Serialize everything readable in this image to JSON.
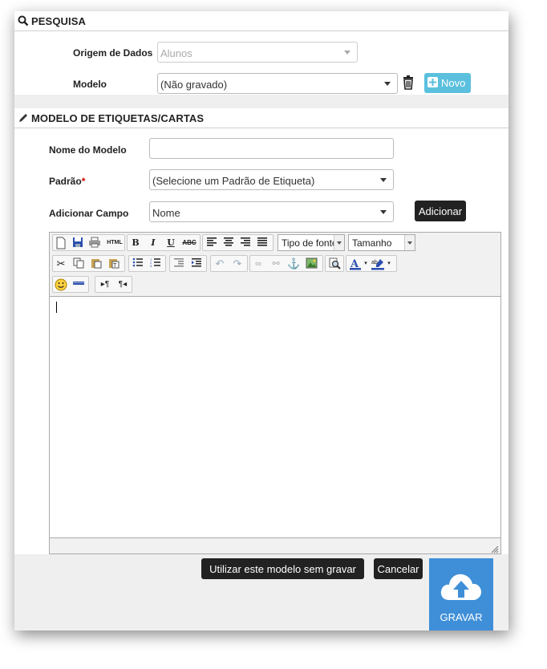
{
  "pesquisa": {
    "title": "PESQUISA",
    "origem_label": "Origem de Dados",
    "origem_value": "Alunos",
    "modelo_label": "Modelo",
    "modelo_value": "(Não gravado)",
    "novo_label": "Novo"
  },
  "modelo_etiquetas": {
    "title": "MODELO DE ETIQUETAS/CARTAS",
    "nome_label": "Nome do Modelo",
    "nome_value": "",
    "padrao_label": "Padrão",
    "required_mark": "*",
    "padrao_value": "(Selecione um Padrão de Etiqueta)",
    "campo_label": "Adicionar Campo",
    "campo_value": "Nome",
    "adicionar_label": "Adicionar"
  },
  "editor": {
    "font_combo": "Tipo de fonte",
    "size_combo": "Tamanho",
    "content": ""
  },
  "actions": {
    "use_without_save": "Utilizar este modelo sem gravar",
    "cancel": "Cancelar",
    "save": "GRAVAR"
  },
  "colors": {
    "accent_blue": "#3f8fd8",
    "info_blue": "#5bc0de",
    "dark_button": "#222222",
    "required": "#cc0000"
  }
}
